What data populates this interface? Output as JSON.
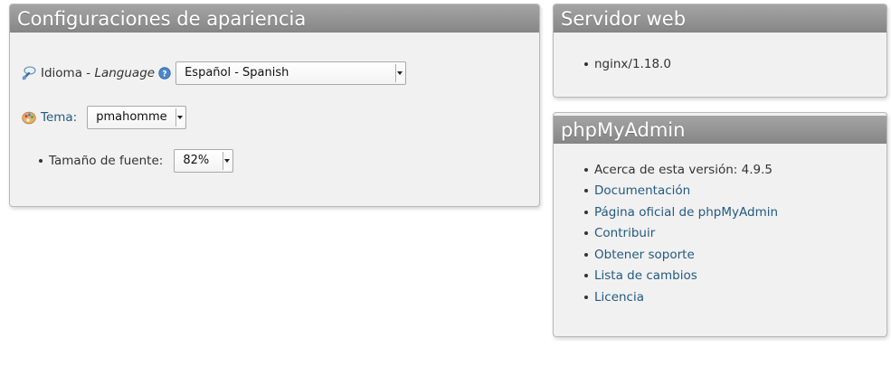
{
  "appearance": {
    "title": "Configuraciones de apariencia",
    "language_label": "Idioma - ",
    "language_label_italic": "Language",
    "language_value": "Español - Spanish",
    "theme_label": "Tema:",
    "theme_value": "pmahomme",
    "font_size_label": "Tamaño de fuente:",
    "font_size_value": "82%",
    "icons": {
      "language": "globe-language-icon",
      "help": "help-icon",
      "theme": "palette-icon"
    }
  },
  "webserver": {
    "title": "Servidor web",
    "items": [
      "nginx/1.18.0"
    ]
  },
  "phpmyadmin": {
    "title": "phpMyAdmin",
    "version_text": "Acerca de esta versión: 4.9.5",
    "links": [
      "Documentación",
      "Página oficial de phpMyAdmin",
      "Contribuir",
      "Obtener soporte",
      "Lista de cambios",
      "Licencia"
    ]
  },
  "colors": {
    "header": "#959595",
    "panel_bg": "#f1f1f1",
    "link": "#235a81"
  }
}
